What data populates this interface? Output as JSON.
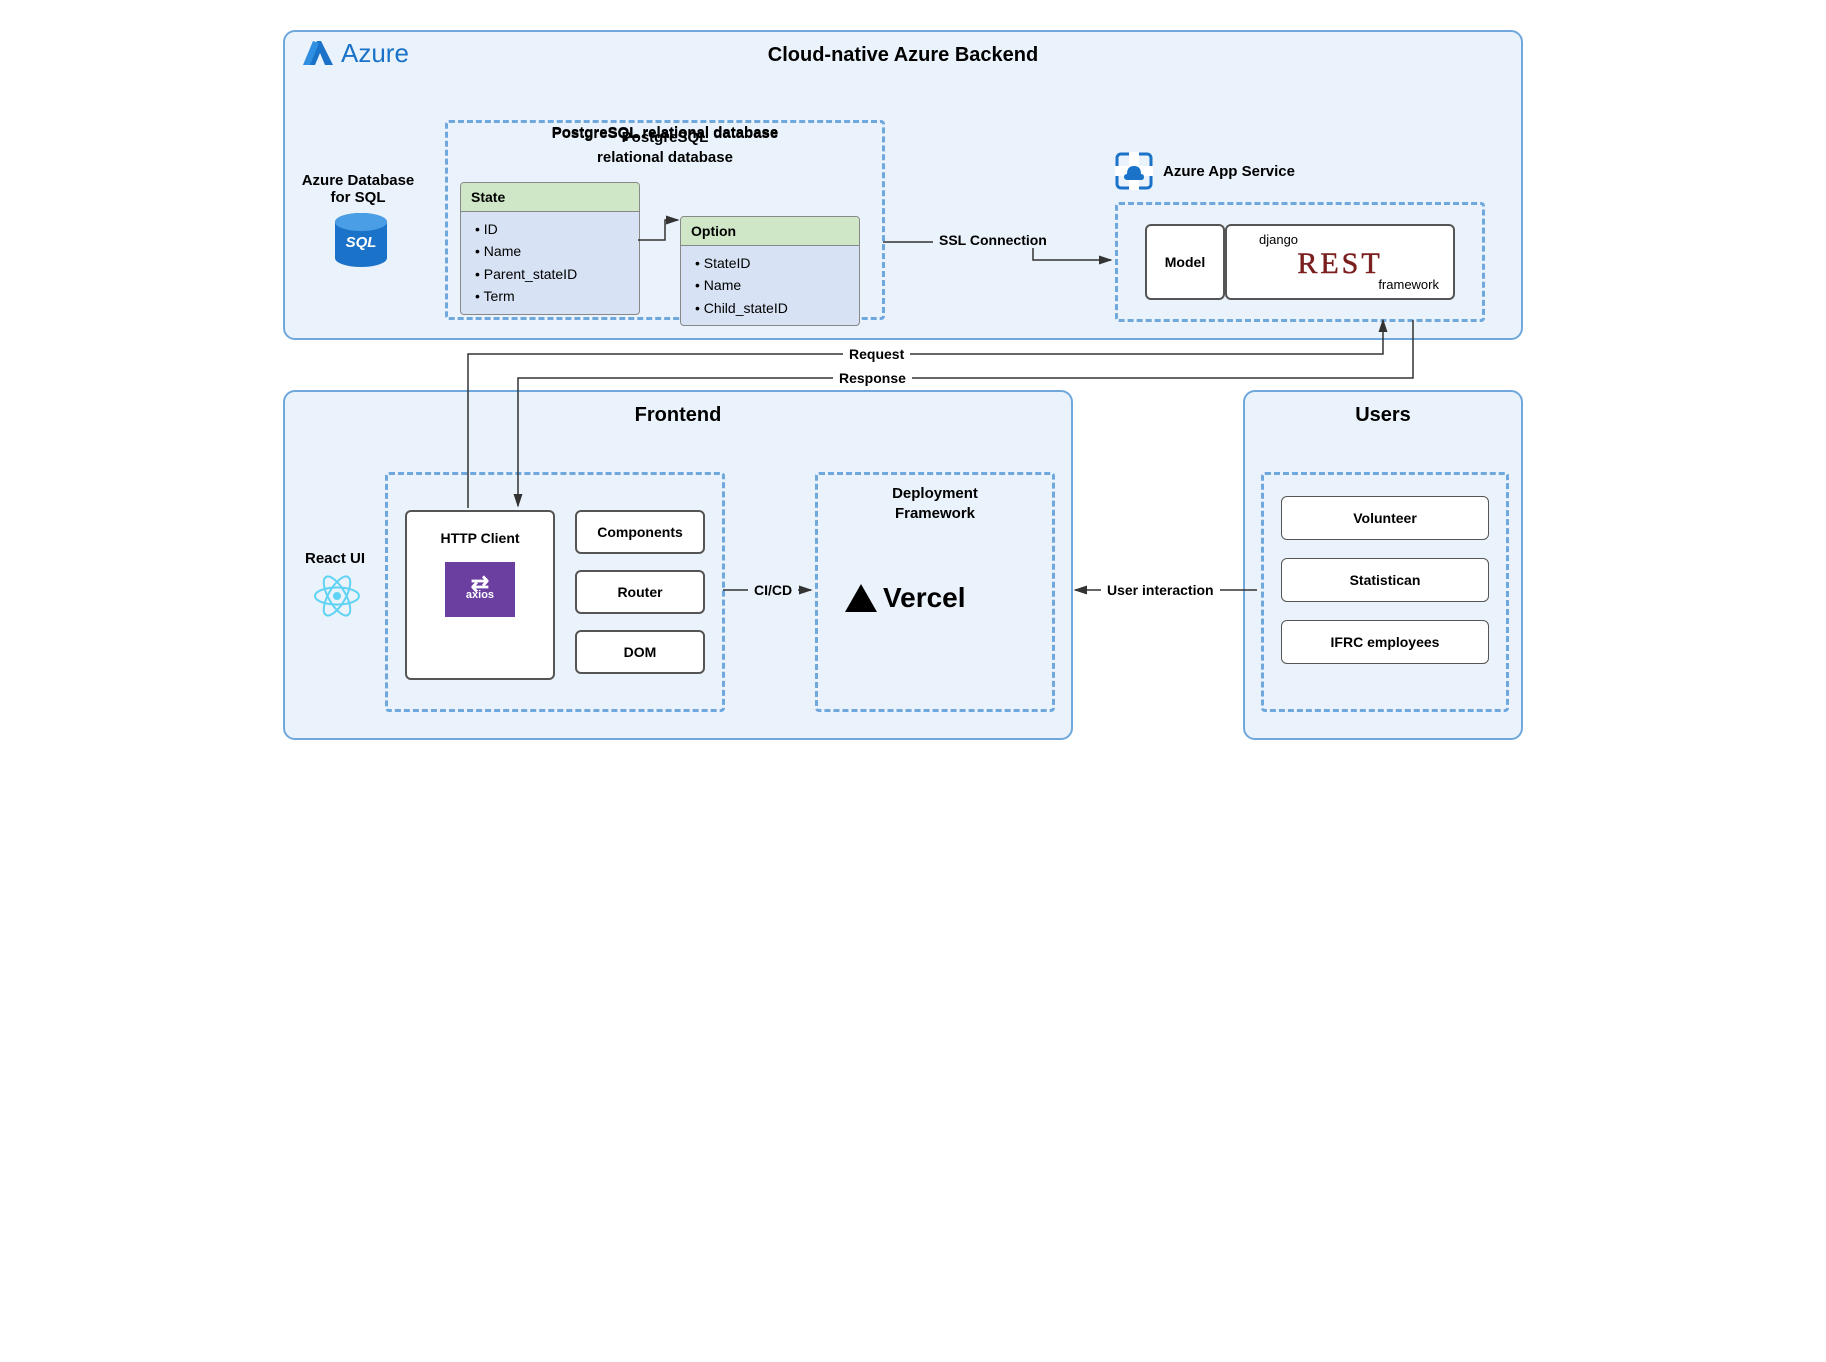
{
  "backend": {
    "title": "Cloud-native Azure Backend",
    "azure_brand": "Azure",
    "db_label": "Azure Database for SQL",
    "sql_text": "SQL",
    "postgres": {
      "title": "PostgreSQL relational database",
      "state": {
        "name": "State",
        "fields": [
          "ID",
          "Name",
          "Parent_stateID",
          "Term"
        ]
      },
      "option": {
        "name": "Option",
        "fields": [
          "StateID",
          "Name",
          "Child_stateID"
        ]
      }
    },
    "ssl_label": "SSL Connection",
    "app_service": {
      "label": "Azure App Service",
      "model_box": "Model",
      "drf_top": "django",
      "drf_mid": "REST",
      "drf_bot": "framework"
    }
  },
  "frontend": {
    "title": "Frontend",
    "react_label": "React UI",
    "http_client": "HTTP Client",
    "axios_label": "axios",
    "components": "Components",
    "router": "Router",
    "dom": "DOM",
    "cicd_label": "CI/CD",
    "deploy": {
      "title": "Deployment Framework",
      "vercel": "Vercel"
    }
  },
  "users": {
    "title": "Users",
    "list": [
      "Volunteer",
      "Statistican",
      "IFRC employees"
    ],
    "interaction_label": "User interaction"
  },
  "flows": {
    "request": "Request",
    "response": "Response"
  }
}
